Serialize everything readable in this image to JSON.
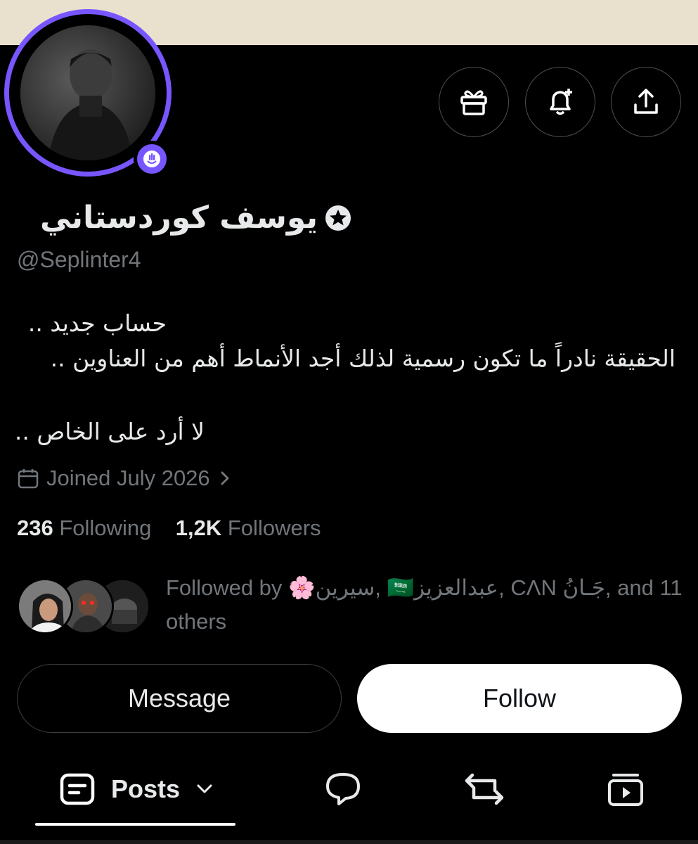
{
  "profile": {
    "display_name": "يوسف كوردستاني",
    "handle": "@Seplinter4",
    "bio_line1": "حساب جديد ..",
    "bio_line2": "الحقيقة نادراً ما تكون رسمية لذلك أجد الأنماط أهم من العناوين ..",
    "bio_line3": "لا أرد على الخاص ..",
    "joined": "Joined July 2026",
    "following_count": "236",
    "following_label": "Following",
    "followers_count": "1,2K",
    "followers_label": "Followers",
    "followed_by": "Followed by 🌸سيرين, 🇸🇦عبدالعزيز, CΛN جَـانُ, and 11 others"
  },
  "actions": {
    "message": "Message",
    "follow": "Follow"
  },
  "tabs": {
    "posts": "Posts"
  },
  "colors": {
    "accent": "#7856ff",
    "muted": "#71767b",
    "text": "#e7e9ea"
  },
  "icons": [
    "gift-icon",
    "bell-plus-icon",
    "share-icon",
    "calendar-icon",
    "chevron-right-icon",
    "verified-star-icon",
    "spaces-icon",
    "posts-icon",
    "chevron-down-icon",
    "reply-icon",
    "repost-icon",
    "media-icon"
  ]
}
